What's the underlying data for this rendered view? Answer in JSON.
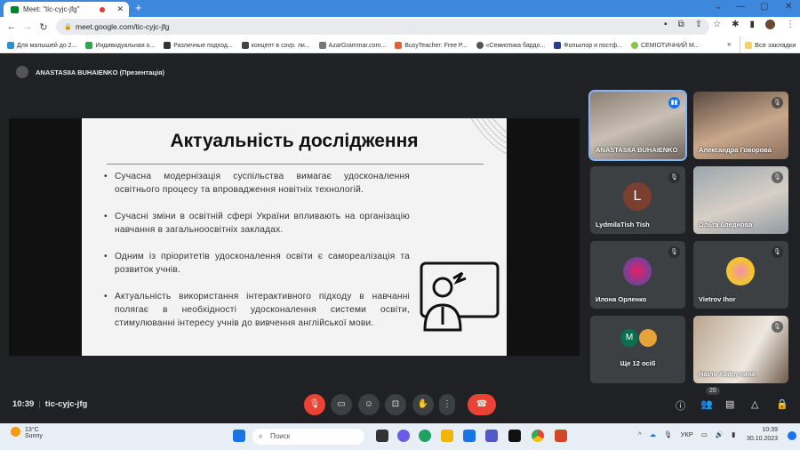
{
  "browser": {
    "tab_title": "Meet: \"tic-cyjc-jfg\"",
    "url": "meet.google.com/tic-cyjc-jfg",
    "bookmarks": [
      {
        "label": "Для малышей до 2...",
        "color": "#2b8fd6"
      },
      {
        "label": "Индивидуальная о...",
        "color": "#2ea84a"
      },
      {
        "label": "Различные подход...",
        "color": "#333"
      },
      {
        "label": "концепт в соvр. ли...",
        "color": "#444"
      },
      {
        "label": "AzarGrammar.com...",
        "color": "#777"
      },
      {
        "label": "BusyTeacher: Free P...",
        "color": "#e0603a"
      },
      {
        "label": "«Семиотика бардо...",
        "color": "#555"
      },
      {
        "label": "Фольклор и постф...",
        "color": "#2a3b8f"
      },
      {
        "label": "СЕМІОТИЧНИЙ М...",
        "color": "#8bc34a"
      }
    ],
    "all_bookmarks": "Все закладки"
  },
  "meet": {
    "presenter": "ANASTASIIA BUHAIENKO (Презентація)",
    "slide": {
      "title": "Актуальність дослідження",
      "bullets": [
        "Сучасна модернізація суспільства вимагає удосконалення освітнього процесу та впровадження новітніх технологій.",
        "Сучасні зміни в освітній сфері України впливають на організацію навчання в загальноосвітніх закладах.",
        "Одним із пріоритетів удосконалення освіти є самореалізація та розвиток учнів.",
        "Актуальність використання інтерактивного підходу в навчанні полягає в необхідності удосконалення системи освіти, стимулюванні інтересу учнів до вивчення англійської мови."
      ]
    },
    "participants": [
      {
        "name": "ANASTASIIA BUHAIENKO",
        "type": "video",
        "speaking": true
      },
      {
        "name": "Александра Говорова",
        "type": "video"
      },
      {
        "name": "LydmilaTish Tish",
        "type": "avatar",
        "initial": "L",
        "color": "#7b3f2f"
      },
      {
        "name": "Ольга бледнова",
        "type": "video"
      },
      {
        "name": "Илона Орленко",
        "type": "avatar",
        "initial": "",
        "color": "#c2185b"
      },
      {
        "name": "Vietrov Ihor",
        "type": "avatar",
        "initial": "",
        "color": "#f4c430"
      },
      {
        "name": "Ще 12 осіб",
        "type": "more",
        "initial": "M",
        "color": "#0b6e4f"
      },
      {
        "name": "Наіля Хайрулина",
        "type": "video"
      }
    ],
    "time": "10:39",
    "code": "tic-cyjc-jfg",
    "participant_count": "20"
  },
  "taskbar": {
    "temp": "13°C",
    "weather": "Sunny",
    "search": "Поиск",
    "lang": "УКР",
    "time": "10:39",
    "date": "30.10.2023"
  }
}
